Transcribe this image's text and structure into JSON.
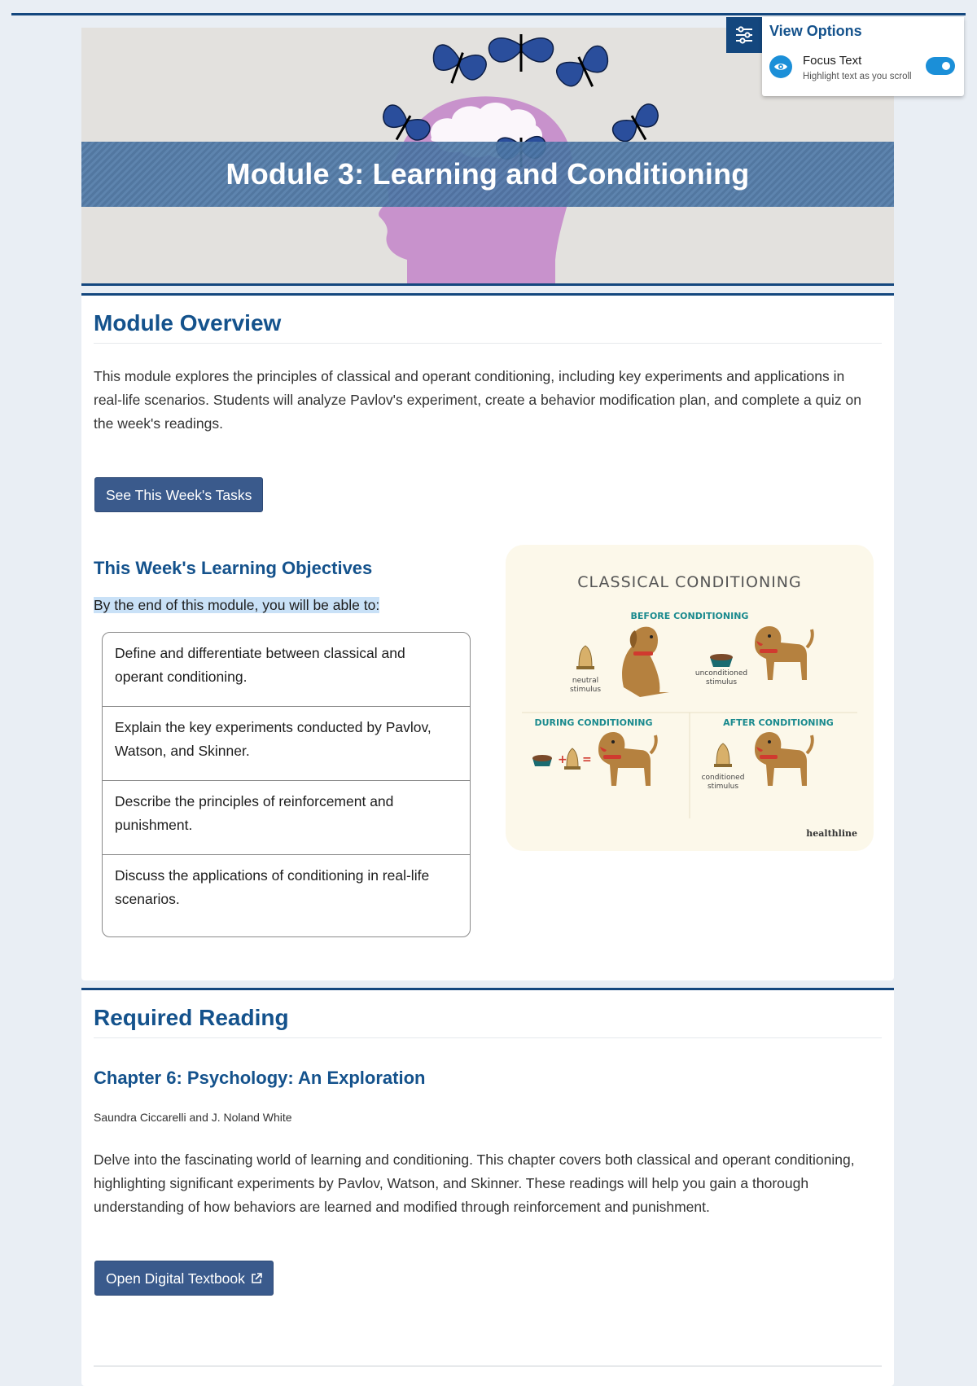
{
  "banner": {
    "title": "Module 3: Learning and Conditioning"
  },
  "view_options": {
    "title": "View Options",
    "focus_label": "Focus Text",
    "focus_sub": "Highlight text as you scroll",
    "focus_enabled": true
  },
  "overview": {
    "heading": "Module Overview",
    "body_lines": [
      "This module explores the principles of classical and operant conditioning, including key experiments and applications in",
      "real-life scenarios. Students will analyze Pavlov's experiment, create a behavior modification plan, and complete a quiz on",
      "the week's readings."
    ],
    "button_label": "See This Week's Tasks",
    "objectives_heading": "This Week's Learning Objectives",
    "objectives_intro": "By the end of this module, you will be able to:",
    "objectives": [
      [
        "Define and differentiate between classical and",
        "operant conditioning."
      ],
      [
        "Explain the key experiments conducted by Pavlov,",
        "Watson, and Skinner."
      ],
      [
        "Describe the principles of reinforcement and",
        "punishment."
      ],
      [
        "Discuss the applications of conditioning in real-life",
        "scenarios."
      ]
    ]
  },
  "infographic": {
    "title": "CLASSICAL CONDITIONING",
    "before": "BEFORE CONDITIONING",
    "during": "DURING CONDITIONING",
    "after": "AFTER CONDITIONING",
    "neutral_1": "neutral",
    "neutral_2": "stimulus",
    "uncond_1": "unconditioned",
    "uncond_2": "stimulus",
    "cond_1": "conditioned",
    "cond_2": "stimulus",
    "brand": "healthline",
    "colors": {
      "teal": "#1a8a8e",
      "dog": "#b5813f",
      "collar": "#d03a2f",
      "bg": "#fcf8ea"
    }
  },
  "reading": {
    "heading": "Required Reading",
    "chapter_title": "Chapter 6: Psychology: An Exploration",
    "authors": "Saundra Ciccarelli and J. Noland White",
    "body_lines": [
      "Delve into the fascinating world of learning and conditioning. This chapter covers both classical and operant conditioning,",
      "highlighting significant experiments by Pavlov, Watson, and Skinner. These readings will help you gain a thorough",
      "understanding of how behaviors are learned and modified through reinforcement and punishment."
    ],
    "button_label": "Open Digital Textbook"
  }
}
